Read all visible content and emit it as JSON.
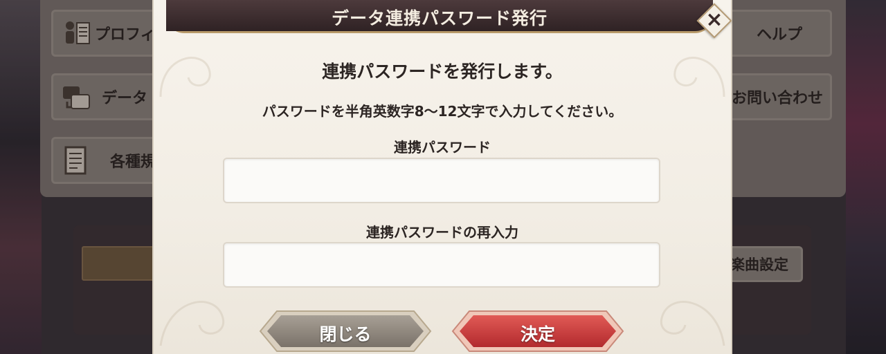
{
  "dialog": {
    "title": "データ連携パスワード発行",
    "message": "連携パスワードを発行します。",
    "instruction": "パスワードを半角英数字8～12文字で入力してください。",
    "password_label": "連携パスワード",
    "password_value": "",
    "repassword_label": "連携パスワードの再入力",
    "repassword_value": "",
    "close_label": "閉じる",
    "confirm_label": "決定",
    "close_icon": "×"
  },
  "background": {
    "profile_label": "プロフィ",
    "data_label": "データ",
    "terms_label": "各種規",
    "help_label": "ヘルプ",
    "contact_label": "お問い合わせ",
    "music_label": "楽曲設定"
  },
  "colors": {
    "title_bar": "#3a2a2c",
    "confirm_button": "#c8393a",
    "close_button": "#8e857c",
    "dialog_bg": "#f4efe7"
  }
}
